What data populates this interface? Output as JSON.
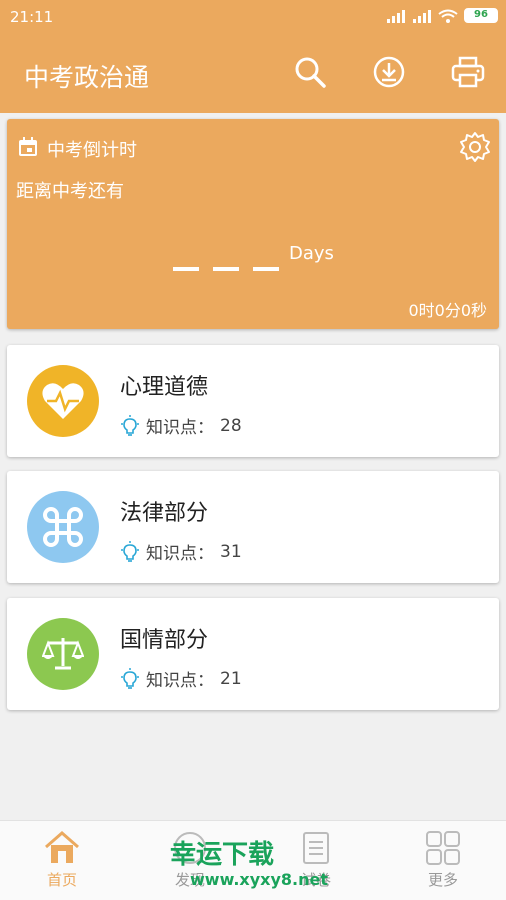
{
  "status": {
    "time": "21:11",
    "battery": "96"
  },
  "appbar": {
    "title": "中考政治通",
    "actions": [
      "search-icon",
      "download-icon",
      "print-icon"
    ]
  },
  "countdown": {
    "title": "中考倒计时",
    "subtitle": "距离中考还有",
    "days_unit": "Days",
    "time_left": "0时0分0秒"
  },
  "topics": [
    {
      "title": "心理道德",
      "meta_label": "知识点：",
      "count": "28",
      "color": "#f0b428",
      "icon": "heart-pulse-icon"
    },
    {
      "title": "法律部分",
      "meta_label": "知识点：",
      "count": "31",
      "color": "#8ec8f0",
      "icon": "command-icon"
    },
    {
      "title": "国情部分",
      "meta_label": "知识点：",
      "count": "21",
      "color": "#8cc850",
      "icon": "scale-icon"
    }
  ],
  "nav": [
    {
      "label": "首页",
      "icon": "home-icon",
      "active": true
    },
    {
      "label": "发现",
      "icon": "discover-icon",
      "active": false
    },
    {
      "label": "试卷",
      "icon": "exam-icon",
      "active": false
    },
    {
      "label": "更多",
      "icon": "grid-icon",
      "active": false
    }
  ],
  "watermark": {
    "text": "幸运下载",
    "url": "www.xyxy8.net"
  },
  "colors": {
    "accent": "#eba95e",
    "card_bg": "#ffffff",
    "page_bg": "#f0f0f0"
  }
}
